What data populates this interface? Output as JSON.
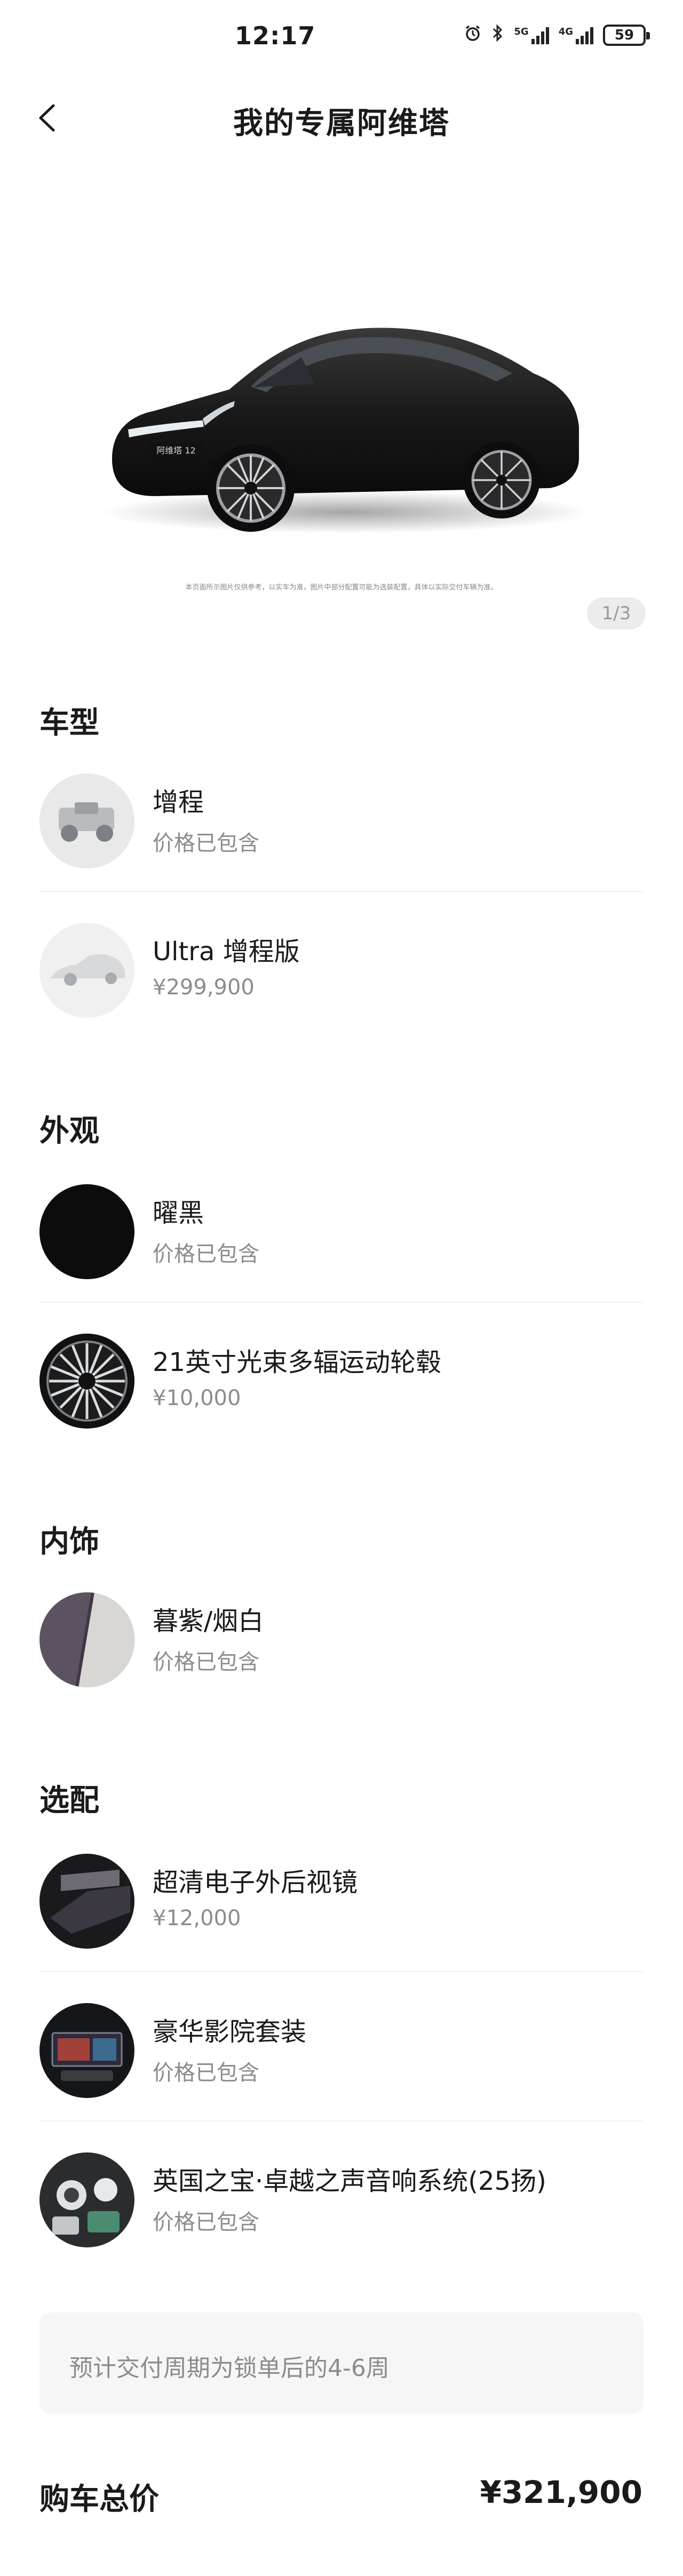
{
  "status_bar": {
    "time": "12:17",
    "network_5g": "5G",
    "network_4g": "4G",
    "battery": "59",
    "icons": [
      "alarm-icon",
      "bluetooth-icon",
      "signal-5g-icon",
      "signal-4g-icon",
      "battery-icon"
    ]
  },
  "header": {
    "title": "我的专属阿维塔",
    "back_icon": "chevron-left-icon"
  },
  "gallery": {
    "disclaimer": "本页面所示图片仅供参考，以实车为准，图片中部分配置可能为选装配置，具体以实际交付车辆为准。",
    "pager": "1/3",
    "badge_text": "阿维塔 12"
  },
  "sections": {
    "model": {
      "title": "车型",
      "items": [
        {
          "name": "增程",
          "price": "价格已包含"
        },
        {
          "name": "Ultra 增程版",
          "price": "¥299,900"
        }
      ]
    },
    "exterior": {
      "title": "外观",
      "items": [
        {
          "name": "曜黑",
          "price": "价格已包含"
        },
        {
          "name": "21英寸光束多辐运动轮毂",
          "price": "¥10,000"
        }
      ]
    },
    "interior": {
      "title": "内饰",
      "items": [
        {
          "name": "暮紫/烟白",
          "price": "价格已包含"
        }
      ]
    },
    "options": {
      "title": "选配",
      "items": [
        {
          "name": "超清电子外后视镜",
          "price": "¥12,000"
        },
        {
          "name": "豪华影院套装",
          "price": "价格已包含"
        },
        {
          "name": "英国之宝·卓越之声音响系统(25扬)",
          "price": "价格已包含"
        }
      ]
    }
  },
  "delivery_notice": "预计交付周期为锁单后的4-6周",
  "total": {
    "label": "购车总价",
    "value": "¥321,900"
  },
  "colors": {
    "text_primary": "#1a1a1a",
    "text_secondary": "#8c8c8c",
    "notice_bg": "#f6f6f6"
  }
}
